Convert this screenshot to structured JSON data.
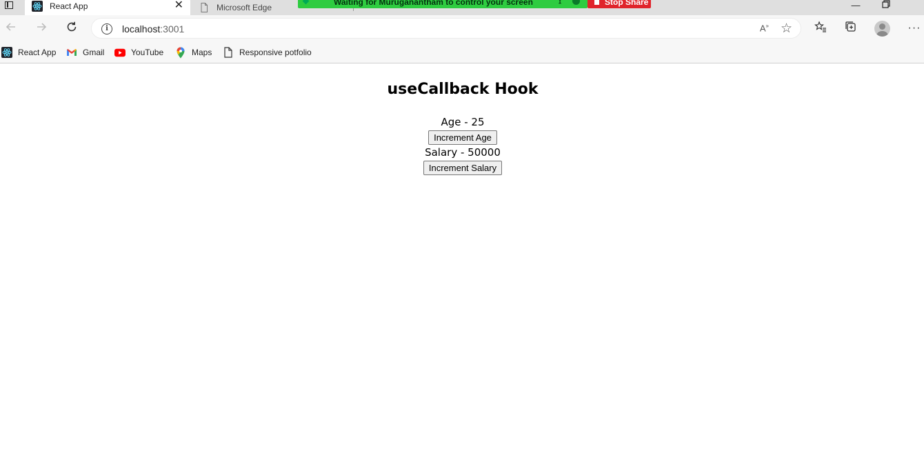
{
  "browser": {
    "tabs": [
      {
        "title": "React App",
        "active": true
      },
      {
        "title": "Microsoft Edge",
        "active": false
      }
    ],
    "share_banner": {
      "text": "Waiting for Muruganantham to control your screen",
      "stop_label": "Stop Share",
      "color": "#2ecc40",
      "stop_color": "#e0242b"
    },
    "address": {
      "host": "localhost",
      "port": ":3001"
    },
    "bookmarks": [
      {
        "label": "React App",
        "icon": "react-icon"
      },
      {
        "label": "Gmail",
        "icon": "gmail-icon"
      },
      {
        "label": "YouTube",
        "icon": "youtube-icon"
      },
      {
        "label": "Maps",
        "icon": "maps-icon"
      },
      {
        "label": "Responsive potfolio",
        "icon": "page-icon"
      }
    ]
  },
  "app": {
    "title": "useCallback Hook",
    "age_text": "Age - 25",
    "increment_age_label": "Increment Age",
    "salary_text": "Salary - 50000",
    "increment_salary_label": "Increment Salary"
  }
}
